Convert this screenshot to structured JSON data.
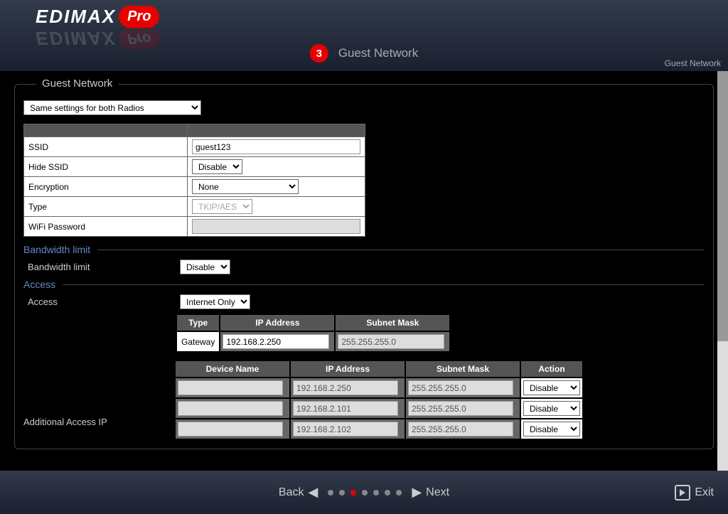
{
  "header": {
    "logo_brand": "EDIMAX",
    "logo_suffix": "Pro",
    "step_number": "3",
    "step_title": "Guest Network",
    "breadcrumb": "Guest Network"
  },
  "fieldset": {
    "legend": "Guest Network",
    "radio_mode": "Same settings for both Radios",
    "settings": {
      "ssid_label": "SSID",
      "ssid_value": "guest123",
      "hide_ssid_label": "Hide SSID",
      "hide_ssid_value": "Disable",
      "encryption_label": "Encryption",
      "encryption_value": "None",
      "type_label": "Type",
      "type_value": "TKIP/AES",
      "wifi_password_label": "WiFi Password",
      "wifi_password_value": ""
    }
  },
  "bandwidth": {
    "section_title": "Bandwidth limit",
    "label": "Bandwidth limit",
    "value": "Disable"
  },
  "access": {
    "section_title": "Access",
    "label": "Access",
    "value": "Internet Only",
    "gateway": {
      "type_header": "Type",
      "ip_header": "IP Address",
      "subnet_header": "Subnet Mask",
      "type_value": "Gateway",
      "ip_value": "192.168.2.250",
      "subnet_value": "255.255.255.0"
    },
    "devices": {
      "additional_label": "Additional Access IP",
      "headers": {
        "device_name": "Device Name",
        "ip": "IP Address",
        "subnet": "Subnet Mask",
        "action": "Action"
      },
      "rows": [
        {
          "name": "",
          "ip": "192.168.2.250",
          "subnet": "255.255.255.0",
          "action": "Disable"
        },
        {
          "name": "",
          "ip": "192.168.2.101",
          "subnet": "255.255.255.0",
          "action": "Disable"
        },
        {
          "name": "",
          "ip": "192.168.2.102",
          "subnet": "255.255.255.0",
          "action": "Disable"
        }
      ]
    }
  },
  "footer": {
    "back": "Back",
    "next": "Next",
    "exit": "Exit",
    "active_step": 2,
    "total_steps": 7
  }
}
